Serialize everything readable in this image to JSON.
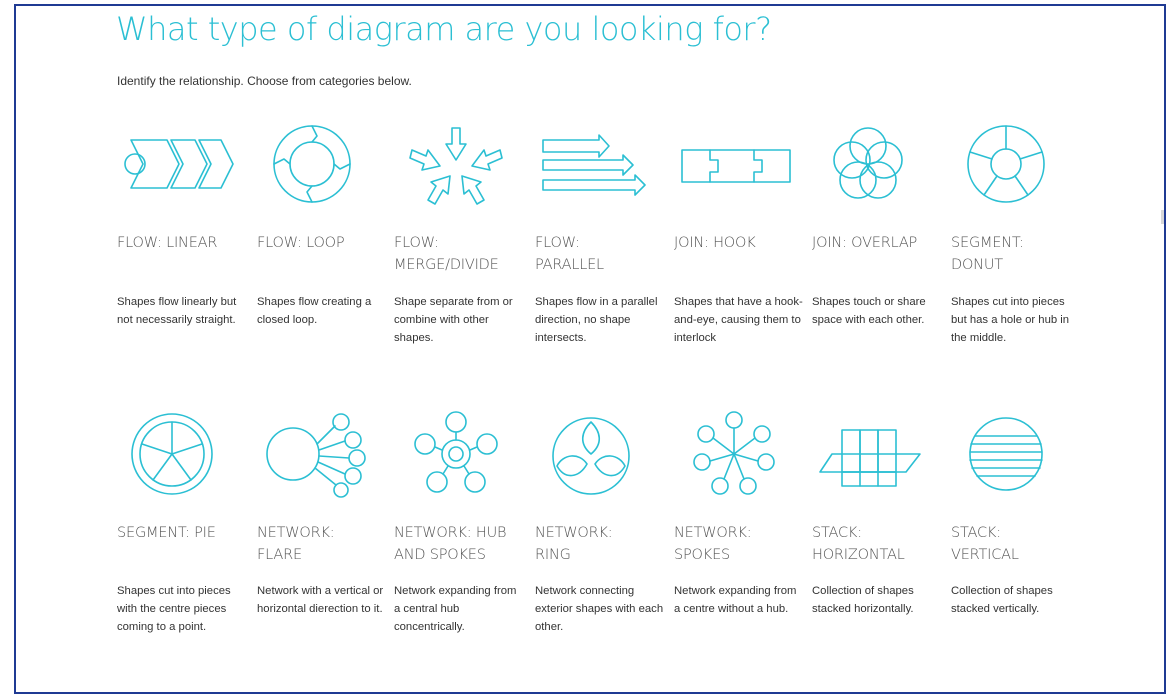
{
  "page": {
    "title": "What type of diagram are you looking for?",
    "subtitle": "Identify the relationship. Choose from categories below."
  },
  "accent_color": "#2bbfd3",
  "categories": [
    {
      "label_line1": "FLOW: LINEAR",
      "label_line2": "",
      "description": "Shapes flow linearly but not necessarily straight.",
      "icon": "flow-linear-icon"
    },
    {
      "label_line1": "FLOW: LOOP",
      "label_line2": "",
      "description": "Shapes flow creating a closed loop.",
      "icon": "flow-loop-icon"
    },
    {
      "label_line1": "FLOW:",
      "label_line2": "MERGE/DIVIDE",
      "description": "Shape separate from or combine with other shapes.",
      "icon": "flow-merge-divide-icon"
    },
    {
      "label_line1": "FLOW:",
      "label_line2": "PARALLEL",
      "description": "Shapes flow in a parallel direction, no shape intersects.",
      "icon": "flow-parallel-icon"
    },
    {
      "label_line1": "JOIN: HOOK",
      "label_line2": "",
      "description": "Shapes that have a hook-and-eye, causing them to interlock",
      "icon": "join-hook-icon"
    },
    {
      "label_line1": "JOIN: OVERLAP",
      "label_line2": "",
      "description": "Shapes touch or share space with each other.",
      "icon": "join-overlap-icon"
    },
    {
      "label_line1": "SEGMENT:",
      "label_line2": "DONUT",
      "description": "Shapes cut into pieces but has a hole or hub in the middle.",
      "icon": "segment-donut-icon"
    },
    {
      "label_line1": "SEGMENT: PIE",
      "label_line2": "",
      "description": "Shapes cut into pieces with the centre pieces coming to a point.",
      "icon": "segment-pie-icon"
    },
    {
      "label_line1": "NETWORK:",
      "label_line2": "FLARE",
      "description": "Network with a vertical or horizontal dierection to it.",
      "icon": "network-flare-icon"
    },
    {
      "label_line1": "NETWORK: HUB",
      "label_line2": "AND SPOKES",
      "description": "Network expanding from a central hub concentrically.",
      "icon": "network-hub-spokes-icon"
    },
    {
      "label_line1": "NETWORK:",
      "label_line2": "RING",
      "description": "Network connecting exterior shapes with each other.",
      "icon": "network-ring-icon"
    },
    {
      "label_line1": "NETWORK:",
      "label_line2": "SPOKES",
      "description": "Network expanding from a centre without a hub.",
      "icon": "network-spokes-icon"
    },
    {
      "label_line1": "STACK:",
      "label_line2": "HORIZONTAL",
      "description": "Collection of shapes stacked horizontally.",
      "icon": "stack-horizontal-icon"
    },
    {
      "label_line1": "STACK:",
      "label_line2": "VERTICAL",
      "description": "Collection of shapes stacked vertically.",
      "icon": "stack-vertical-icon"
    }
  ]
}
